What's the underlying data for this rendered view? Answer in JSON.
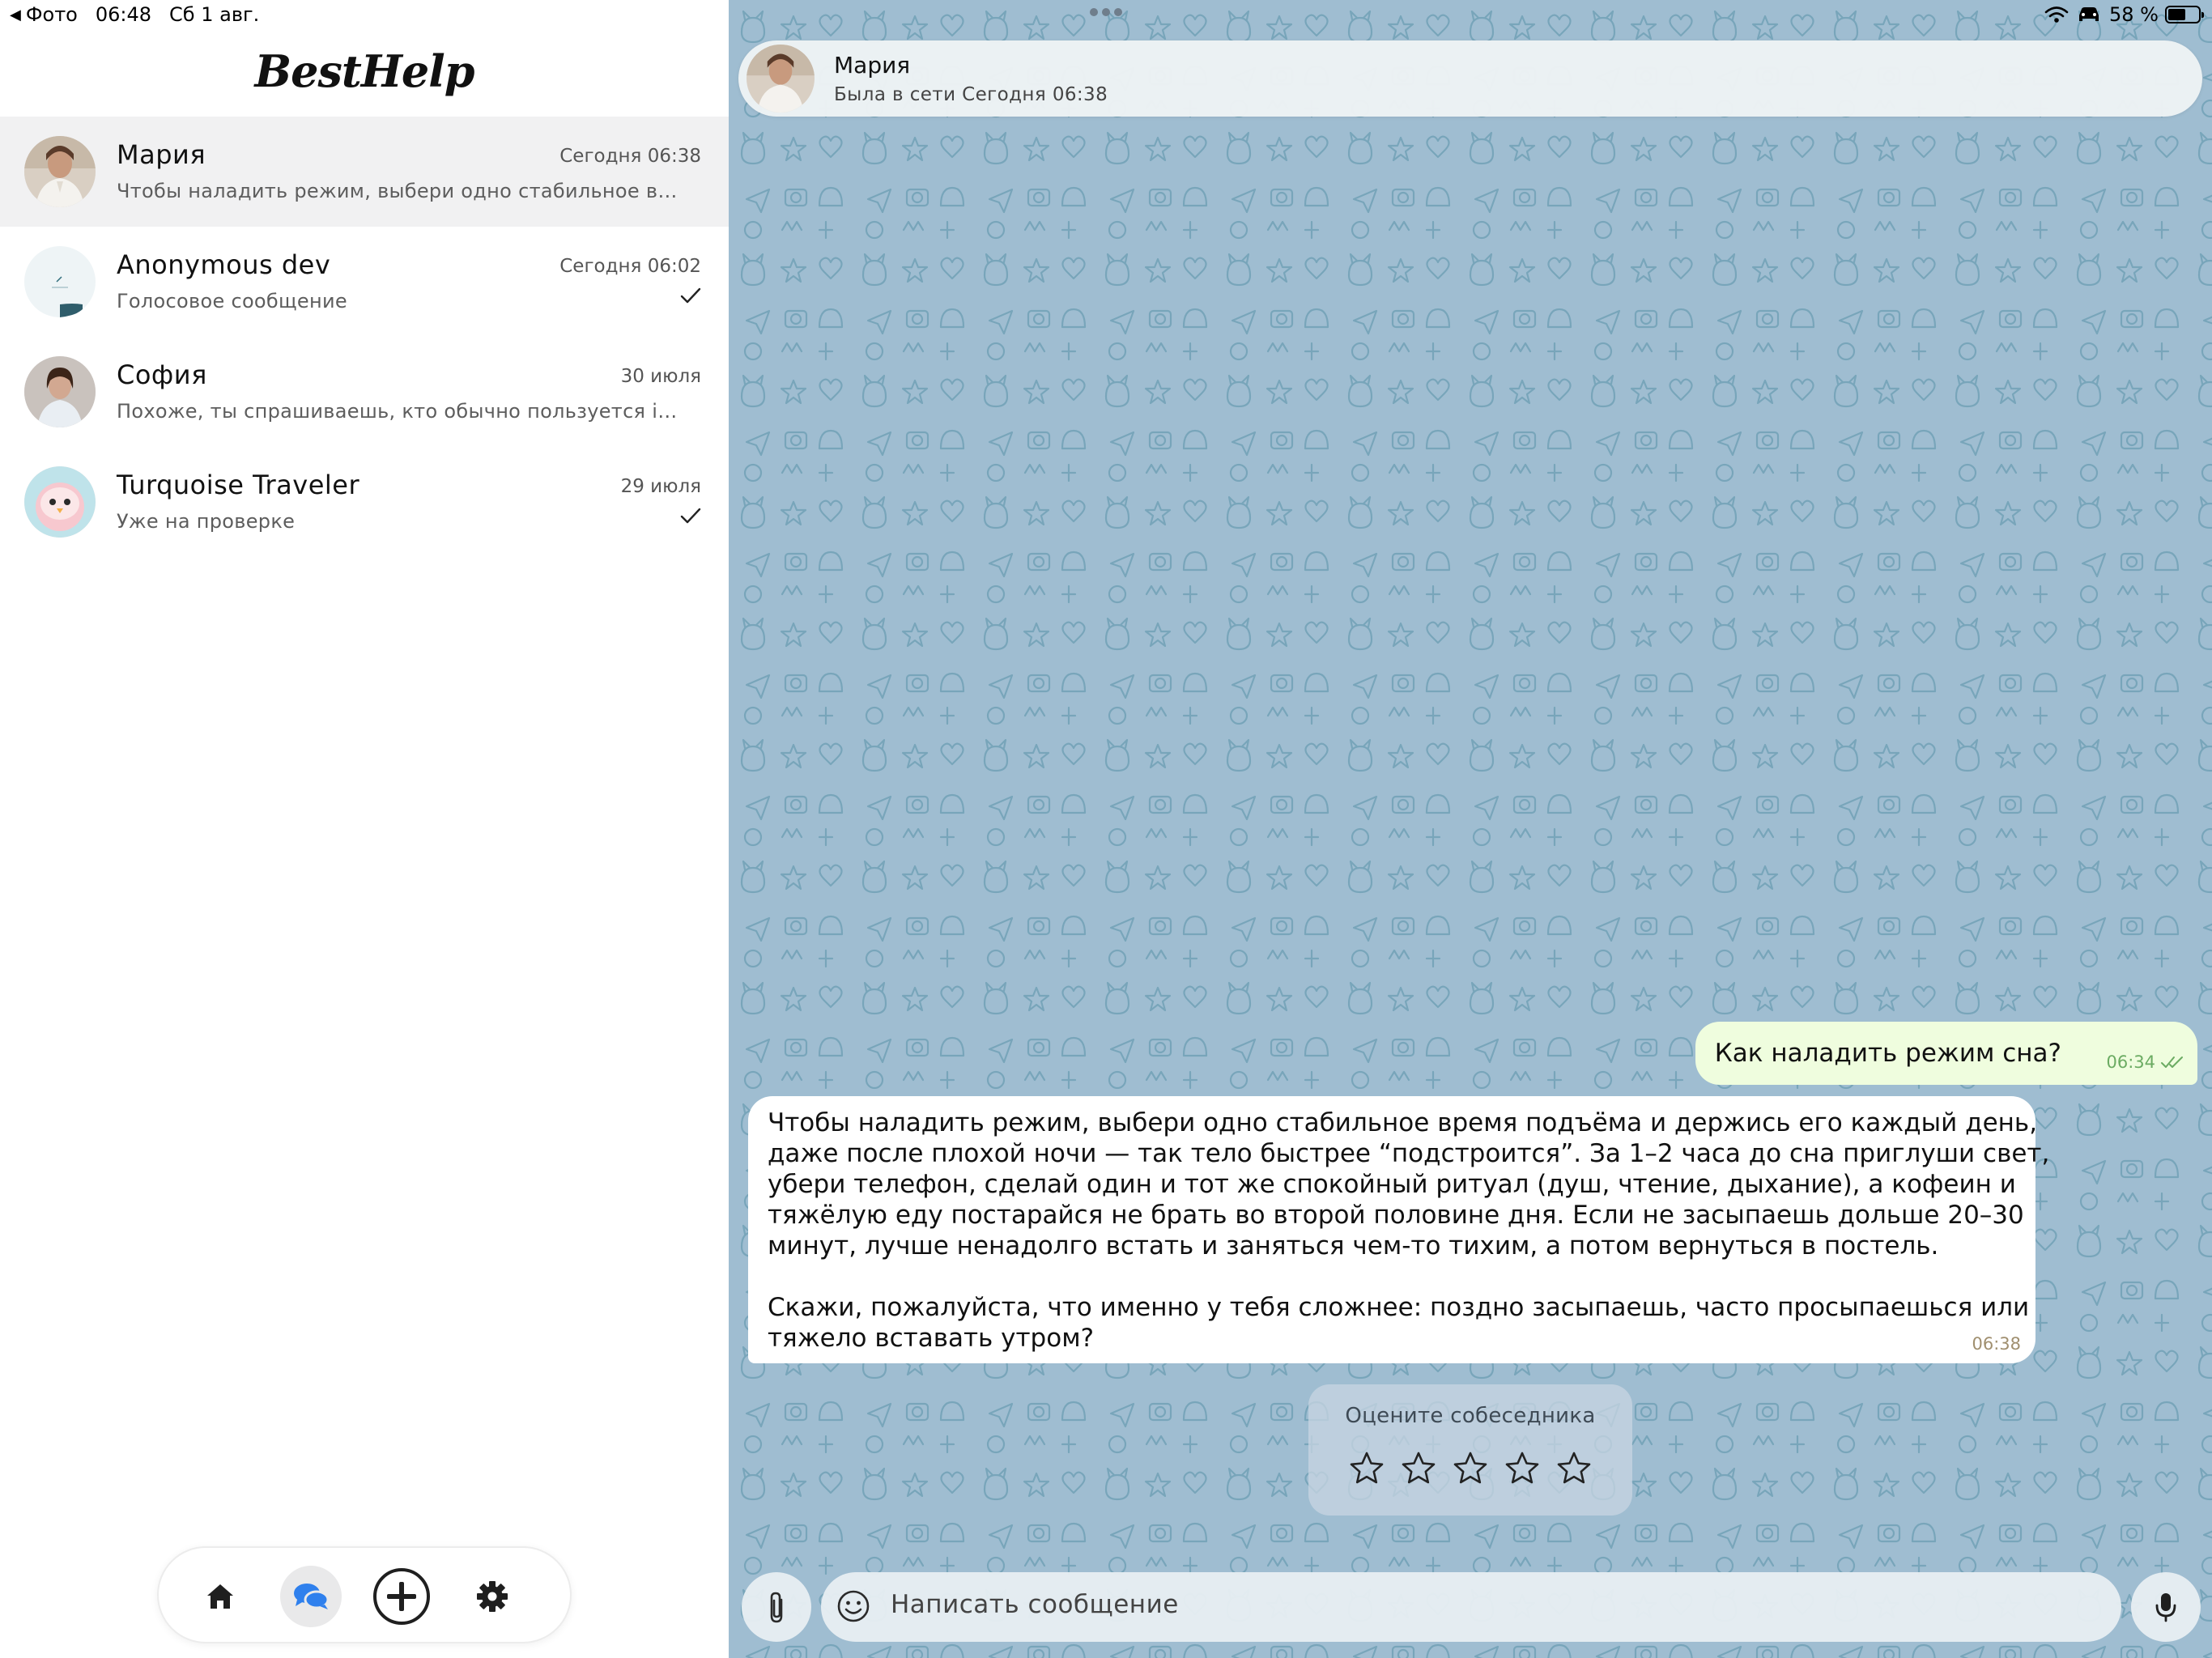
{
  "status_bar": {
    "back_app": "Фото",
    "time": "06:48",
    "date": "Сб 1 авг.",
    "battery": "58 %",
    "battery_level": 0.58
  },
  "sidebar": {
    "brand": "BestHelp",
    "chats": [
      {
        "name": "Мария",
        "time": "Сегодня 06:38",
        "preview": "Чтобы наладить режим, выбери одно стабильное время подъёма и держись его каждый день, даже после плохой ночи",
        "active": true,
        "read": false
      },
      {
        "name": "Anonymous dev",
        "time": "Сегодня 06:02",
        "preview": "Голосовое сообщение",
        "active": false,
        "read": true
      },
      {
        "name": "София",
        "time": "30 июля",
        "preview": "Похоже, ты спрашиваешь, кто обычно пользуется iOS и почему",
        "active": false,
        "read": false
      },
      {
        "name": "Turquoise Traveler",
        "time": "29 июля",
        "preview": "Уже на проверке",
        "active": false,
        "read": true
      }
    ],
    "tabs": [
      {
        "icon": "home-icon"
      },
      {
        "icon": "chats-icon",
        "active": true
      },
      {
        "icon": "plus-circle-icon"
      },
      {
        "icon": "gear-icon"
      }
    ]
  },
  "chat": {
    "header": {
      "name": "Мария",
      "status": "Была в сети Сегодня 06:38"
    },
    "messages": {
      "outgoing": {
        "text": "Как наладить режим сна?",
        "time": "06:34"
      },
      "incoming": {
        "lines": [
          "Чтобы наладить режим, выбери одно стабильное время подъёма и держись его каждый день,",
          "даже после плохой ночи — так тело быстрее “подстроится”. За 1–2 часа до сна приглуши свет,",
          "убери телефон, сделай один и тот же спокойный ритуал (душ, чтение, дыхание), а кофеин и",
          "тяжёлую еду постарайся не брать во второй половине дня. Если не засыпаешь дольше 20–30",
          "минут, лучше ненадолго встать и заняться чем-то тихим, а потом вернуться в постель."
        ],
        "lines2": [
          "Скажи, пожалуйста, что именно у тебя сложнее: поздно засыпаешь, часто просыпаешься или",
          "тяжело вставать утром?"
        ],
        "time": "06:38"
      }
    },
    "rating": {
      "title": "Оцените собеседника",
      "max": 5,
      "value": 0
    },
    "composer": {
      "placeholder": "Написать сообщение"
    }
  },
  "colors": {
    "chat_bg": "#9fbdd1",
    "outgoing_bubble": "#effdde",
    "incoming_bubble": "#ffffff",
    "accent": "#2f80ed"
  }
}
